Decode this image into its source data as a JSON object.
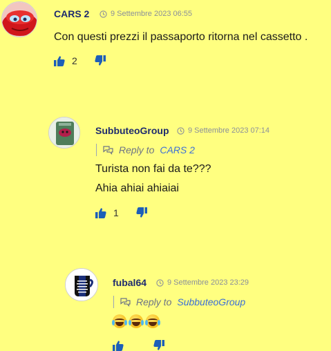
{
  "comments": [
    {
      "author": "CARS 2",
      "date": "9 Settembre 2023 06:55",
      "text": "Con questi prezzi il passaporto ritorna nel cassetto .",
      "upvotes": "2",
      "avatar": "cars-avatar"
    },
    {
      "author": "SubbuteoGroup",
      "date": "9 Settembre 2023 07:14",
      "reply_label": "Reply to",
      "reply_to": "CARS 2",
      "text_line1": "Turista non fai da te???",
      "text_line2": "Ahia ahiai ahiaiai",
      "upvotes": "1",
      "avatar": "subbuteo-avatar"
    },
    {
      "author": "fubal64",
      "date": "9 Settembre 2023 23:29",
      "reply_label": "Reply to",
      "reply_to": "SubbuteoGroup",
      "emojis": "😂😂😂",
      "avatar": "keep-calm-avatar"
    }
  ],
  "colors": {
    "background": "#ffff80",
    "author": "#1e2a6e",
    "link": "#3b6fd6",
    "thumbs": "#1d5fb8"
  }
}
